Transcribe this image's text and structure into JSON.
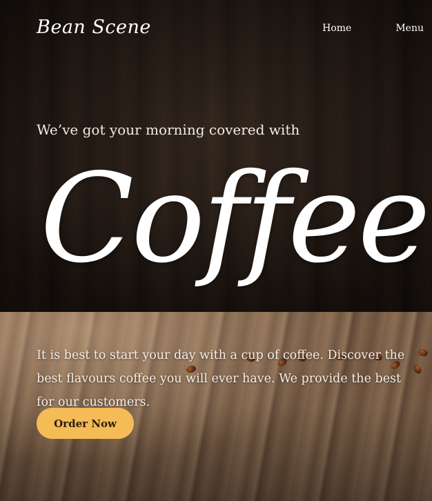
{
  "brand": {
    "logo_text": "Bean Scene"
  },
  "nav": {
    "items": [
      "Home",
      "Menu"
    ]
  },
  "hero": {
    "tagline": "We’ve got your morning covered with",
    "headline": "Coffee",
    "description": "It is best to start your day with a cup of coffee. Discover the best flavours coffee you will ever have. We provide the best for our customers.",
    "cta_label": "Order Now"
  },
  "colors": {
    "accent": "#f4bb57",
    "text": "#ffffff"
  }
}
